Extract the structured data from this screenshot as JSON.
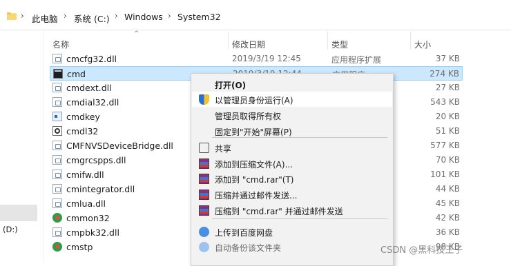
{
  "address": {
    "segments": [
      "此电脑",
      "系统 (C:)",
      "Windows",
      "System32"
    ],
    "separator": "›"
  },
  "columns": {
    "name": "名称",
    "date": "修改日期",
    "type": "类型",
    "size": "大小"
  },
  "nav": {
    "drive_label": "(D:)"
  },
  "files": [
    {
      "name": "cmcfg32.dll",
      "date": "2019/3/19 12:45",
      "type": "应用程序扩展",
      "size": "37 KB",
      "icon": "dll"
    },
    {
      "name": "cmd",
      "date": "2019/3/19 12:44",
      "type": "应用程序",
      "size": "274 KB",
      "icon": "cmd"
    },
    {
      "name": "cmdext.dll",
      "size": "27 KB",
      "icon": "dll"
    },
    {
      "name": "cmdial32.dll",
      "size": "543 KB",
      "icon": "dll"
    },
    {
      "name": "cmdkey",
      "size": "20 KB",
      "icon": "key"
    },
    {
      "name": "cmdl32",
      "size": "51 KB",
      "icon": "cmdl"
    },
    {
      "name": "CMFNVSDeviceBridge.dll",
      "size": "577 KB",
      "icon": "dll"
    },
    {
      "name": "cmgrcspps.dll",
      "size": "70 KB",
      "icon": "dll"
    },
    {
      "name": "cmifw.dll",
      "size": "101 KB",
      "icon": "dll"
    },
    {
      "name": "cmintegrator.dll",
      "size": "44 KB",
      "icon": "dll"
    },
    {
      "name": "cmlua.dll",
      "size": "45 KB",
      "icon": "dll"
    },
    {
      "name": "cmmon32",
      "size": "42 KB",
      "icon": "gear"
    },
    {
      "name": "cmpbk32.dll",
      "size": "36 KB",
      "icon": "dll"
    },
    {
      "name": "cmstp",
      "size": "98 KB",
      "icon": "gear"
    }
  ],
  "context_menu": {
    "items": [
      {
        "label": "打开(O)",
        "bold": true,
        "icon": ""
      },
      {
        "label": "以管理员身份运行(A)",
        "icon": "uac-shield-icon",
        "hover": true
      },
      {
        "label": "管理员取得所有权",
        "icon": ""
      },
      {
        "label": "固定到\"开始\"屏幕(P)",
        "icon": ""
      },
      {
        "label": "共享",
        "icon": "share-icon"
      },
      {
        "label": "添加到压缩文件(A)...",
        "icon": "winrar-icon"
      },
      {
        "label": "添加到 \"cmd.rar\"(T)",
        "icon": "winrar-icon"
      },
      {
        "label": "压缩并通过邮件发送...",
        "icon": "winrar-icon"
      },
      {
        "label": "压缩到 \"cmd.rar\" 并通过邮件发送",
        "icon": "winrar-icon"
      },
      {
        "label": "上传到百度网盘",
        "icon": "baidu-cloud-icon"
      },
      {
        "label": "自动备份该文件夹",
        "icon": "baidu-cloud-icon",
        "disabled": true
      }
    ]
  },
  "watermark": "CSDN @黑科技王子",
  "colors": {
    "selected_row": "#cce8ff",
    "selected_border": "#99d1ff",
    "menu_bg": "#f2f2f2"
  }
}
